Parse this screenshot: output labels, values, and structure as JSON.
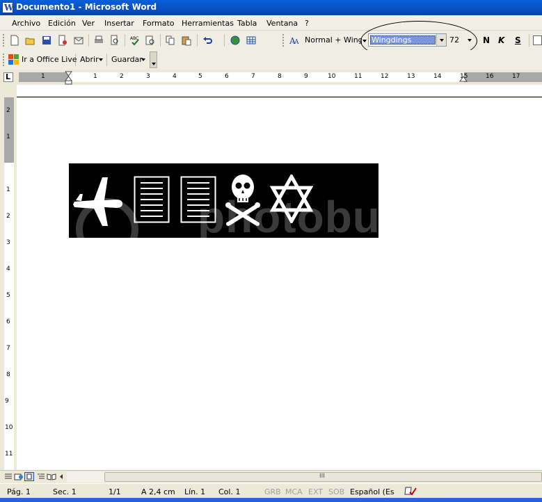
{
  "window": {
    "title": "Documento1 - Microsoft Word",
    "app_icon_letter": "W"
  },
  "menu": {
    "items": [
      "Archivo",
      "Edición",
      "Ver",
      "Insertar",
      "Formato",
      "Herramientas",
      "Tabla",
      "Ventana",
      "?"
    ]
  },
  "toolbar": {
    "style_value": "Normal + Wingdings",
    "font_value": "Wingdings",
    "size_value": "72",
    "bold_label": "N",
    "italic_label": "K",
    "underline_label": "S",
    "icons": [
      "new-document-icon",
      "open-folder-icon",
      "save-icon",
      "permission-icon",
      "email-icon",
      "print-icon",
      "print-preview-icon",
      "spelling-icon",
      "research-icon",
      "copy-icon",
      "paste-icon",
      "undo-icon",
      "globe-icon",
      "table-icon",
      "styles-icon"
    ]
  },
  "toolbar2": {
    "office_live_label": "Ir a Office Live",
    "open_label": "Abrir",
    "save_label": "Guardar"
  },
  "ruler": {
    "h_numbers": [
      "1",
      "1",
      "2",
      "3",
      "4",
      "5",
      "6",
      "7",
      "8",
      "9",
      "10",
      "11",
      "12",
      "13",
      "14",
      "15",
      "16",
      "17"
    ],
    "v_numbers": [
      "2",
      "1",
      "1",
      "2",
      "3",
      "4",
      "5",
      "6",
      "7",
      "8",
      "9",
      "10",
      "11"
    ],
    "tab_selector": "L"
  },
  "document": {
    "watermark": "photobu",
    "glyphs": [
      "airplane-icon",
      "document-icon",
      "document-icon",
      "skull-crossbones-icon",
      "star-of-david-icon"
    ]
  },
  "scroll": {
    "thumb_grip": "III"
  },
  "status": {
    "page": "Pág. 1",
    "section": "Sec. 1",
    "pages": "1/1",
    "at": "A  2,4 cm",
    "line": "Lín. 1",
    "col": "Col. 1",
    "grb": "GRB",
    "mca": "MCA",
    "ext": "EXT",
    "sob": "SOB",
    "language": "Español (Es"
  },
  "colors": {
    "titlebar": "#0855c8",
    "selection": "#7a96df"
  }
}
